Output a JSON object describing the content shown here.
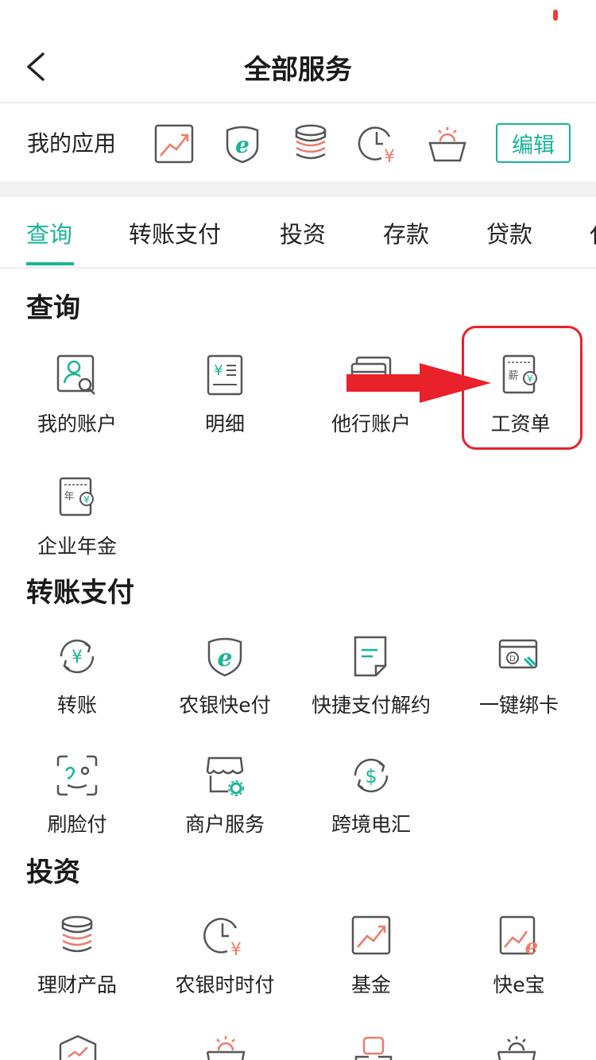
{
  "header": {
    "title": "全部服务"
  },
  "my_apps": {
    "label": "我的应用",
    "edit_label": "编辑",
    "icons": [
      "fund-chart-icon",
      "e-pay-icon",
      "coins-stack-icon",
      "clock-yen-icon",
      "basket-icon"
    ]
  },
  "tabs": [
    {
      "label": "查询",
      "active": true
    },
    {
      "label": "转账支付"
    },
    {
      "label": "投资"
    },
    {
      "label": "存款"
    },
    {
      "label": "贷款"
    },
    {
      "label": "代"
    }
  ],
  "sections": {
    "query": {
      "title": "查询",
      "items": [
        {
          "label": "我的账户",
          "icon": "account-search-icon"
        },
        {
          "label": "明细",
          "icon": "detail-list-icon"
        },
        {
          "label": "他行账户",
          "icon": "cards-icon"
        },
        {
          "label": "工资单",
          "icon": "salary-slip-icon"
        },
        {
          "label": "企业年金",
          "icon": "pension-icon"
        }
      ]
    },
    "transfer": {
      "title": "转账支付",
      "items": [
        {
          "label": "转账",
          "icon": "transfer-icon"
        },
        {
          "label": "农银快e付",
          "icon": "e-pay-icon"
        },
        {
          "label": "快捷支付解约",
          "icon": "document-icon"
        },
        {
          "label": "一键绑卡",
          "icon": "bind-card-icon"
        },
        {
          "label": "刷脸付",
          "icon": "face-pay-icon"
        },
        {
          "label": "商户服务",
          "icon": "merchant-icon"
        },
        {
          "label": "跨境电汇",
          "icon": "cross-border-icon"
        }
      ]
    },
    "invest": {
      "title": "投资",
      "items": [
        {
          "label": "理财产品",
          "icon": "coins-stack-icon"
        },
        {
          "label": "农银时时付",
          "icon": "clock-yen-icon"
        },
        {
          "label": "基金",
          "icon": "fund-chart-icon"
        },
        {
          "label": "快e宝",
          "icon": "kuai-e-bao-icon"
        }
      ]
    }
  },
  "colors": {
    "accent": "#19b39a",
    "icon_red": "#f07a6a",
    "highlight": "#e8212b"
  }
}
